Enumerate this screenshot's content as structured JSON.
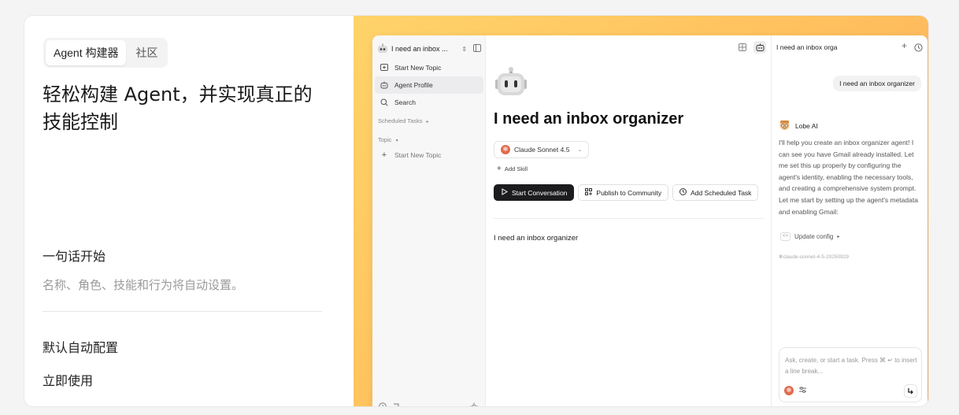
{
  "tabs": [
    {
      "label": "Agent 构建器",
      "active": true
    },
    {
      "label": "社区",
      "active": false
    }
  ],
  "headline": "轻松构建 Agent，并实现真正的技能控制",
  "features": [
    {
      "title": "一句话开始",
      "desc": "名称、角色、技能和行为将自动设置。"
    },
    {
      "title": "默认自动配置",
      "desc": ""
    },
    {
      "title": "立即使用",
      "desc": ""
    }
  ],
  "colors": {
    "accent_gradient_start": "#ffd36a",
    "accent_gradient_end": "#ffac5c",
    "primary_button": "#1c1c1e",
    "claude": "#e06b4f"
  },
  "app": {
    "sidebar": {
      "agent_name": "I need an inbox ...",
      "items": [
        {
          "label": "Start New Topic",
          "icon": "new-topic-icon"
        },
        {
          "label": "Agent Profile",
          "icon": "robot-icon",
          "active": true
        },
        {
          "label": "Search",
          "icon": "search-icon"
        }
      ],
      "group_scheduled": "Scheduled Tasks",
      "group_topic": "Topic",
      "topic_new": "Start New Topic"
    },
    "main": {
      "title": "I need an inbox organizer",
      "model": "Claude Sonnet 4.5",
      "add_skill": "Add Skill",
      "actions": {
        "start": "Start Conversation",
        "publish": "Publish to Community",
        "schedule": "Add Scheduled Task"
      },
      "prompt": "I need an inbox organizer"
    },
    "chat": {
      "title": "I need an inbox orga",
      "user_message": "I need an inbox organizer",
      "assistant_name": "Lobe AI",
      "assistant_message": "I'll help you create an inbox organizer agent! I can see you have Gmail already installed. Let me set this up properly by configuring the agent's identity, enabling the necessary tools, and creating a comprehensive system prompt.",
      "assistant_message_2": "Let me start by setting up the agent's metadata and enabling Gmail:",
      "tool_call": "Update config",
      "model_id": "claude-sonnet-4-5-20250929",
      "composer_placeholder": "Ask, create, or start a task. Press ⌘ ↵ to insert a line break..."
    }
  }
}
